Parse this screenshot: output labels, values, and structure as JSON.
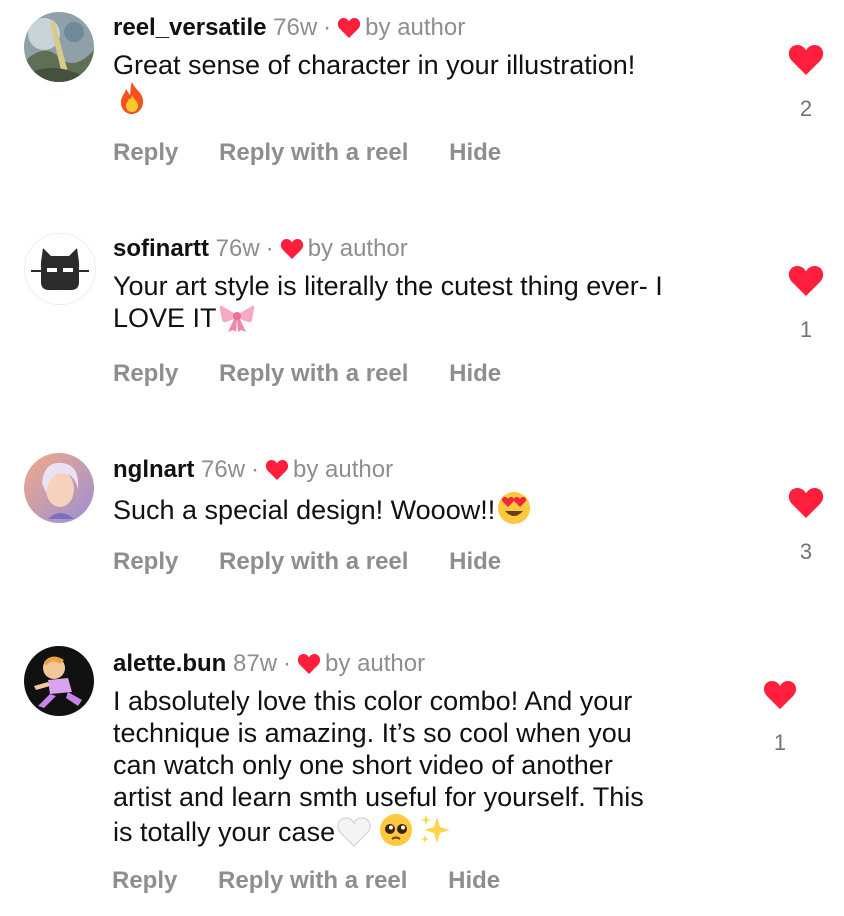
{
  "colors": {
    "heart": "#ff1e3c",
    "muted": "#8e8e8e",
    "text": "#111111"
  },
  "comments": [
    {
      "username": "reel_versatile",
      "age": "76w",
      "badge": "by author",
      "text": "Great sense of character in your illustration!",
      "emoji": "fire-emoji",
      "likes": "2",
      "actions": {
        "reply": "Reply",
        "reply_reel": "Reply with a reel",
        "hide": "Hide"
      }
    },
    {
      "username": "sofinartt",
      "age": "76w",
      "badge": "by author",
      "text_line1": "Your art style is literally the cutest thing ever- I",
      "text_line2": "LOVE IT",
      "emoji": "ribbon-emoji",
      "likes": "1",
      "actions": {
        "reply": "Reply",
        "reply_reel": "Reply with a reel",
        "hide": "Hide"
      }
    },
    {
      "username": "nglnart",
      "age": "76w",
      "badge": "by author",
      "text": "Such a special design! Wooow!!",
      "emoji": "heart-eyes-emoji",
      "likes": "3",
      "actions": {
        "reply": "Reply",
        "reply_reel": "Reply with a reel",
        "hide": "Hide"
      }
    },
    {
      "username": "alette.bun",
      "age": "87w",
      "badge": "by author",
      "lines": [
        "I absolutely love this color combo! And your",
        "technique is amazing. It’s so cool when you",
        "can watch only one short video of another",
        "artist and learn smth useful for yourself. This",
        "is totally your case"
      ],
      "emojis": [
        "white-heart-emoji",
        "pleading-face-emoji",
        "sparkles-emoji"
      ],
      "likes": "1",
      "actions": {
        "reply": "Reply",
        "reply_reel": "Reply with a reel",
        "hide": "Hide"
      }
    }
  ]
}
